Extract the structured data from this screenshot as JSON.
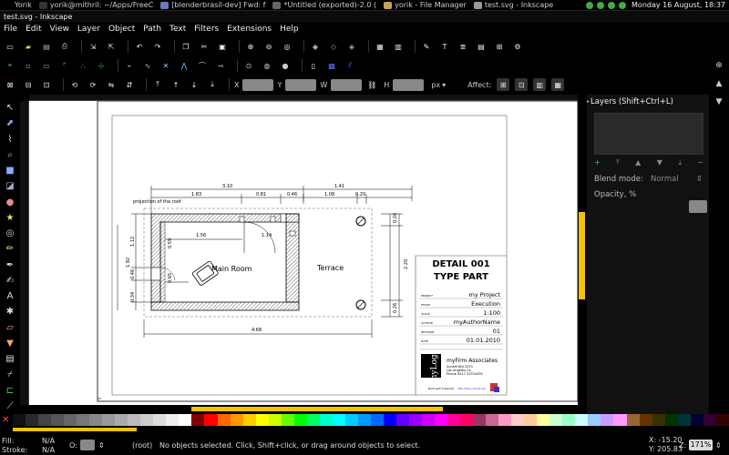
{
  "panel": {
    "tasks": [
      {
        "label": "Yorik",
        "icon": "user-menu-icon",
        "color": "#000000"
      },
      {
        "label": "yorik@mithril: ~/Apps/FreeC",
        "icon": "terminal-icon",
        "color": "#333333"
      },
      {
        "label": "[blenderbrasil-dev] Fwd: f",
        "icon": "browser-icon",
        "color": "#6a7ab8"
      },
      {
        "label": "*Untitled (exported)-2.0 (",
        "icon": "gimp-icon",
        "color": "#666666"
      },
      {
        "label": "yorik - File Manager",
        "icon": "folder-icon",
        "color": "#c8a060"
      },
      {
        "label": "test.svg - Inkscape",
        "icon": "inkscape-icon",
        "color": "#999999"
      }
    ],
    "clock": "Monday 16 August, 18:37"
  },
  "window": {
    "title": "test.svg - Inkscape"
  },
  "menu": [
    "File",
    "Edit",
    "View",
    "Layer",
    "Object",
    "Path",
    "Text",
    "Filters",
    "Extensions",
    "Help"
  ],
  "controls": {
    "x_label": "X",
    "y_label": "Y",
    "w_label": "W",
    "h_label": "H",
    "unit": "px",
    "affect": "Affect:"
  },
  "layers": {
    "title": "Layers (Shift+Ctrl+L)",
    "blend_label": "Blend mode:",
    "blend_value": "Normal",
    "opacity_label": "Opacity, %"
  },
  "drawing": {
    "dims_top1": [
      "3.10",
      "1.41"
    ],
    "dims_top2": [
      "1.83",
      "0.81",
      "0.46",
      "1.08",
      "0.20"
    ],
    "roof_note": "projection of the roof",
    "dims_inner": [
      "1.56",
      "1.14"
    ],
    "rooms": [
      "Main Room",
      "Terrace"
    ],
    "dims_left_outer": "1.92",
    "dims_left_inner": [
      "1.12",
      "0.46",
      "0.34"
    ],
    "dims_left_inside": [
      "0.59",
      "0.65"
    ],
    "dims_right": [
      "0.26",
      "2.20",
      "0.26"
    ],
    "dim_bottom": "4.68"
  },
  "titleblock": {
    "title1": "DETAIL 001",
    "title2": "TYPE PART",
    "rows": [
      {
        "label": "PROJECT",
        "value": "my Project"
      },
      {
        "label": "PHASE",
        "value": "Execution"
      },
      {
        "label": "SCALE",
        "value": "1:100"
      },
      {
        "label": "AUTHOR",
        "value": "myAuthorName"
      },
      {
        "label": "REVISION",
        "value": "01"
      },
      {
        "label": "DATE",
        "value": "01.01.2010"
      }
    ],
    "logo": "myLogo",
    "firm": "myFirm Associates",
    "address": [
      "Sunset Bld 2233",
      "Los Angeles CA",
      "Phone 0017 22334455"
    ],
    "built_with": "Built with FreeCAD",
    "url": "http://free-cad.sf.net"
  },
  "status": {
    "fill_label": "Fill:",
    "fill_value": "N/A",
    "stroke_label": "Stroke:",
    "stroke_value": "N/A",
    "opacity_o": "O:",
    "layer": "(root)",
    "message": "No objects selected. Click, Shift+click, or drag around objects to select.",
    "x_coord": "X: -15.20",
    "y_coord": "Y: 205.83",
    "z_label": "Z:",
    "zoom": "171%"
  },
  "palette": [
    "#111111",
    "#2a2a2a",
    "#444444",
    "#555555",
    "#666666",
    "#777777",
    "#888888",
    "#999999",
    "#aaaaaa",
    "#bbbbbb",
    "#cccccc",
    "#dddddd",
    "#eeeeee",
    "#ffffff",
    "#800000",
    "#ff0000",
    "#ff6600",
    "#ff9900",
    "#ffcc00",
    "#ffff00",
    "#ccff00",
    "#66ff00",
    "#00ff00",
    "#00ff66",
    "#00ffcc",
    "#00ffff",
    "#00ccff",
    "#0099ff",
    "#0066ff",
    "#0000ff",
    "#6600ff",
    "#9900ff",
    "#cc00ff",
    "#ff00ff",
    "#ff0099",
    "#ff0066",
    "#993366",
    "#cc6699",
    "#ff99cc",
    "#ffcccc",
    "#ffcc99",
    "#ffff99",
    "#ccffcc",
    "#99ffcc",
    "#ccffff",
    "#99ccff",
    "#cc99ff",
    "#ff99ff",
    "#996633",
    "#663300",
    "#333300",
    "#003300",
    "#003333",
    "#000033",
    "#330033",
    "#330000"
  ]
}
